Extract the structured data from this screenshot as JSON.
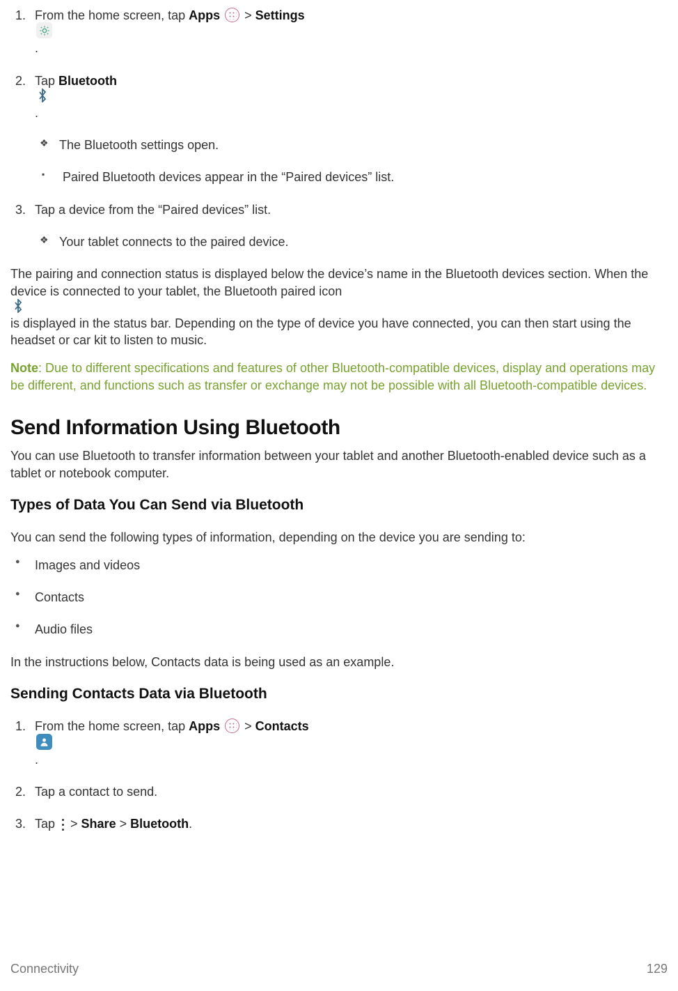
{
  "steps_a": {
    "items": [
      {
        "num": "1.",
        "pre": "From the home screen, tap ",
        "bold1": "Apps",
        "mid1": " > ",
        "bold2": "Settings",
        "post": "."
      },
      {
        "num": "2.",
        "pre": "Tap ",
        "bold1": "Bluetooth",
        "post": " .",
        "sub_diamond": [
          "The Bluetooth settings open."
        ],
        "sub_square": [
          "Paired Bluetooth devices appear in the “Paired devices” list."
        ]
      },
      {
        "num": "3.",
        "text": "Tap a device from the “Paired devices” list.",
        "sub_diamond": [
          "Your tablet connects to the paired device."
        ]
      }
    ]
  },
  "para1_a": "The pairing and connection status is displayed below the device’s name in the Bluetooth devices section. When the device is connected to your tablet, the Bluetooth paired icon ",
  "para1_b": " is displayed in the status bar. Depending on the type of device you have connected, you can then start using the headset or car kit to listen to music.",
  "note": {
    "label": "Note",
    "text": ": Due to different specifications and features of other Bluetooth-compatible devices, display and operations may be different, and functions such as transfer or exchange may not be possible with all Bluetooth-compatible devices."
  },
  "heading1": "Send Information Using Bluetooth",
  "para2": "You can use Bluetooth to transfer information between your tablet and another Bluetooth-enabled device such as a tablet or notebook computer.",
  "subheading1": "Types of Data You Can Send via Bluetooth",
  "para3": "You can send the following types of information, depending on the device you are sending to:",
  "bullets": [
    "Images and videos",
    "Contacts",
    "Audio files"
  ],
  "para4": "In the instructions below, Contacts data is being used as an example.",
  "subheading2": "Sending Contacts Data via Bluetooth",
  "steps_b": {
    "items": [
      {
        "num": "1.",
        "pre": "From the home screen, tap ",
        "bold1": "Apps",
        "mid1": " > ",
        "bold2": "Contacts",
        "post": "."
      },
      {
        "num": "2.",
        "text": "Tap a contact to send."
      },
      {
        "num": "3.",
        "pre": "Tap ",
        "mid1": " > ",
        "bold1": "Share",
        "mid2": " > ",
        "bold2": "Bluetooth",
        "post": "."
      }
    ]
  },
  "footer": {
    "section": "Connectivity",
    "page": "129"
  }
}
